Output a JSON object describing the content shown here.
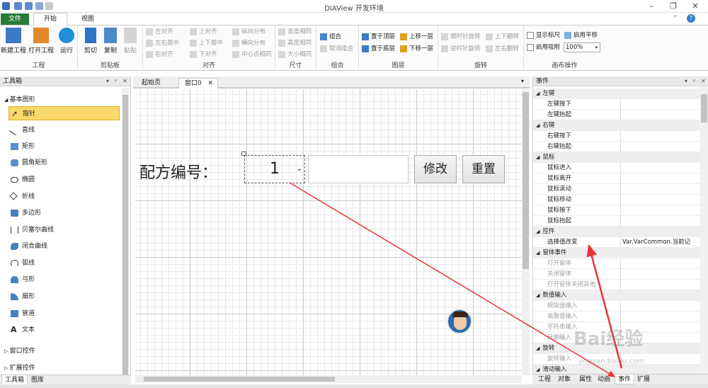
{
  "app": {
    "title": "DIAView 开发环境"
  },
  "ribbon": {
    "tabs": {
      "file": "文件",
      "home": "开始",
      "view": "视图"
    },
    "project": {
      "new": "新建工程",
      "open": "打开工程",
      "run": "运行",
      "label": "工程"
    },
    "clipboard": {
      "cut": "剪切",
      "copy": "复制",
      "paste": "粘贴",
      "label": "剪贴板"
    },
    "align": {
      "left": "左对齐",
      "hcenter": "左右居中",
      "right": "右对齐",
      "top": "上对齐",
      "vcenter": "上下居中",
      "bottom": "下对齐",
      "vdist": "纵向分布",
      "hdist": "横向分布",
      "center": "中心点相同",
      "label": "对齐"
    },
    "size": {
      "width": "宽度相同",
      "height": "高度相同",
      "both": "大小相同",
      "label": "尺寸"
    },
    "group": {
      "group": "组合",
      "ungroup": "取消组合",
      "label": "组合"
    },
    "layer": {
      "top": "置于顶层",
      "bottom": "置于底层",
      "up": "上移一层",
      "down": "下移一层",
      "label": "图层"
    },
    "rotate": {
      "cw": "顺时针旋转",
      "ccw": "逆时针旋转",
      "flipv": "上下翻转",
      "fliph": "左右翻转",
      "label": "旋转"
    },
    "canvas": {
      "ruler": "显示标尺",
      "snap": "启用吸附",
      "pan": "启用平移",
      "zoom": "100%",
      "label": "画布操作"
    }
  },
  "toolbox": {
    "title": "工具箱",
    "category_basic": "基本图形",
    "items": [
      "指针",
      "直线",
      "矩形",
      "圆角矩形",
      "椭圆",
      "折线",
      "多边形",
      "贝塞尔曲线",
      "闭合曲线",
      "弧线",
      "弓形",
      "扇形",
      "管道",
      "文本"
    ],
    "category_window": "窗口控件",
    "category_ext": "扩展控件",
    "bottom_tabs": [
      "工具箱",
      "图库"
    ]
  },
  "document": {
    "tabs": [
      "起始页",
      "窗口0"
    ],
    "recipe_label": "配方编号：",
    "combo_value": "1",
    "modify_button": "修改",
    "reset_button": "重置"
  },
  "events": {
    "title": "事件",
    "categories": [
      {
        "name": "左键",
        "rows": [
          {
            "k": "左键按下",
            "v": ""
          },
          {
            "k": "左键抬起",
            "v": ""
          }
        ]
      },
      {
        "name": "右键",
        "rows": [
          {
            "k": "右键按下",
            "v": ""
          },
          {
            "k": "右键抬起",
            "v": ""
          }
        ]
      },
      {
        "name": "鼠标",
        "rows": [
          {
            "k": "鼠标进入",
            "v": ""
          },
          {
            "k": "鼠标离开",
            "v": ""
          },
          {
            "k": "鼠标滚动",
            "v": ""
          },
          {
            "k": "鼠标移动",
            "v": ""
          },
          {
            "k": "鼠标按下",
            "v": ""
          },
          {
            "k": "鼠标抬起",
            "v": ""
          }
        ]
      },
      {
        "name": "控件",
        "rows": [
          {
            "k": "选择值改变",
            "v": "Var.VarCommon.当前记"
          }
        ]
      },
      {
        "name": "窗体事件",
        "rows": [
          {
            "k": "打开窗体",
            "v": ""
          },
          {
            "k": "关闭窗体",
            "v": ""
          },
          {
            "k": "打开窗体关闭其他",
            "v": ""
          }
        ]
      },
      {
        "name": "数值输入",
        "rows": [
          {
            "k": "模拟值输入",
            "v": ""
          },
          {
            "k": "离散值输入",
            "v": ""
          },
          {
            "k": "字符串输入",
            "v": ""
          },
          {
            "k": "日期输入",
            "v": ""
          }
        ]
      },
      {
        "name": "旋转",
        "rows": [
          {
            "k": "旋转输入",
            "v": ""
          }
        ]
      },
      {
        "name": "滑动输入",
        "rows": []
      }
    ],
    "bottom_tabs": [
      "工程",
      "对象",
      "属性",
      "动画",
      "事件",
      "扩展"
    ]
  },
  "watermark": {
    "brand": "Bai经验",
    "url": "jingyan.baidu.com"
  },
  "colors": {
    "file_tab": "#2b7a3a",
    "selected_item": "#fbd86b",
    "annotation_arrow": "#e8343a"
  }
}
